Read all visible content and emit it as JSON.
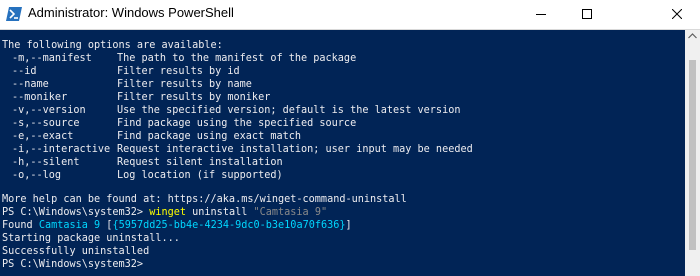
{
  "window": {
    "title": "Administrator: Windows PowerShell",
    "colors": {
      "background": "#012456",
      "text": "#eeedf0",
      "command": "#ffff00",
      "string": "#8a8a8a",
      "highlight": "#00d7ff"
    }
  },
  "console": {
    "header": "The following options are available:",
    "options": [
      {
        "flag": "-m,--manifest",
        "description": "The path to the manifest of the package"
      },
      {
        "flag": "--id",
        "description": "Filter results by id"
      },
      {
        "flag": "--name",
        "description": "Filter results by name"
      },
      {
        "flag": "--moniker",
        "description": "Filter results by moniker"
      },
      {
        "flag": "-v,--version",
        "description": "Use the specified version; default is the latest version"
      },
      {
        "flag": "-s,--source",
        "description": "Find package using the specified source"
      },
      {
        "flag": "-e,--exact",
        "description": "Find package using exact match"
      },
      {
        "flag": "-i,--interactive",
        "description": "Request interactive installation; user input may be needed"
      },
      {
        "flag": "-h,--silent",
        "description": "Request silent installation"
      },
      {
        "flag": "-o,--log",
        "description": "Log location (if supported)"
      }
    ],
    "help": "More help can be found at: https://aka.ms/winget-command-uninstall",
    "prompt1": "PS C:\\Windows\\system32> ",
    "command_exe": "winget",
    "command_args": " uninstall ",
    "command_string": "\"Camtasia 9\"",
    "found_prefix": "Found ",
    "found_name": "Camtasia 9",
    "found_mid": " [",
    "found_id": "{5957dd25-bb4e-4234-9dc0-b3e10a70f636}",
    "found_suffix": "]",
    "starting": "Starting package uninstall...",
    "success": "Successfully uninstalled",
    "prompt2": "PS C:\\Windows\\system32>"
  }
}
